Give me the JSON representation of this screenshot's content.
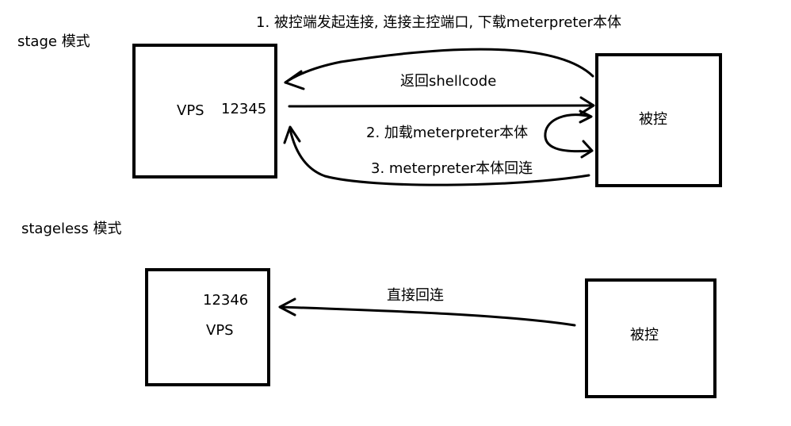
{
  "sections": {
    "stage_title": "stage 模式",
    "stageless_title": "stageless 模式"
  },
  "stage": {
    "vps_label": "VPS",
    "port_label": "12345",
    "target_label": "被控",
    "step1": "1. 被控端发起连接, 连接主控端口, 下载meterpreter本体",
    "return_shellcode": "返回shellcode",
    "step2": "2. 加载meterpreter本体",
    "step3": "3. meterpreter本体回连"
  },
  "stageless": {
    "port_label": "12346",
    "vps_label": "VPS",
    "target_label": "被控",
    "direct_connect": "直接回连"
  }
}
